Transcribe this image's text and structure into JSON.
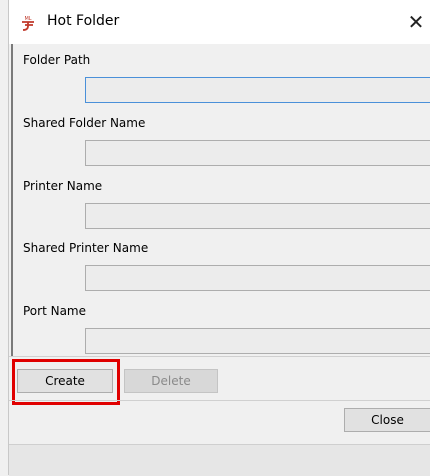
{
  "window": {
    "title": "Hot Folder",
    "app_icon": "app-logo-icon",
    "close_glyph": "✕"
  },
  "fields": [
    {
      "label": "Folder Path",
      "value": ""
    },
    {
      "label": "Shared Folder Name",
      "value": ""
    },
    {
      "label": "Printer Name",
      "value": ""
    },
    {
      "label": "Shared Printer Name",
      "value": ""
    },
    {
      "label": "Port Name",
      "value": ""
    }
  ],
  "actions": {
    "create_label": "Create",
    "delete_label": "Delete",
    "close_label": "Close"
  },
  "colors": {
    "highlight": "#e00000",
    "focus_border": "#4a90d9"
  }
}
